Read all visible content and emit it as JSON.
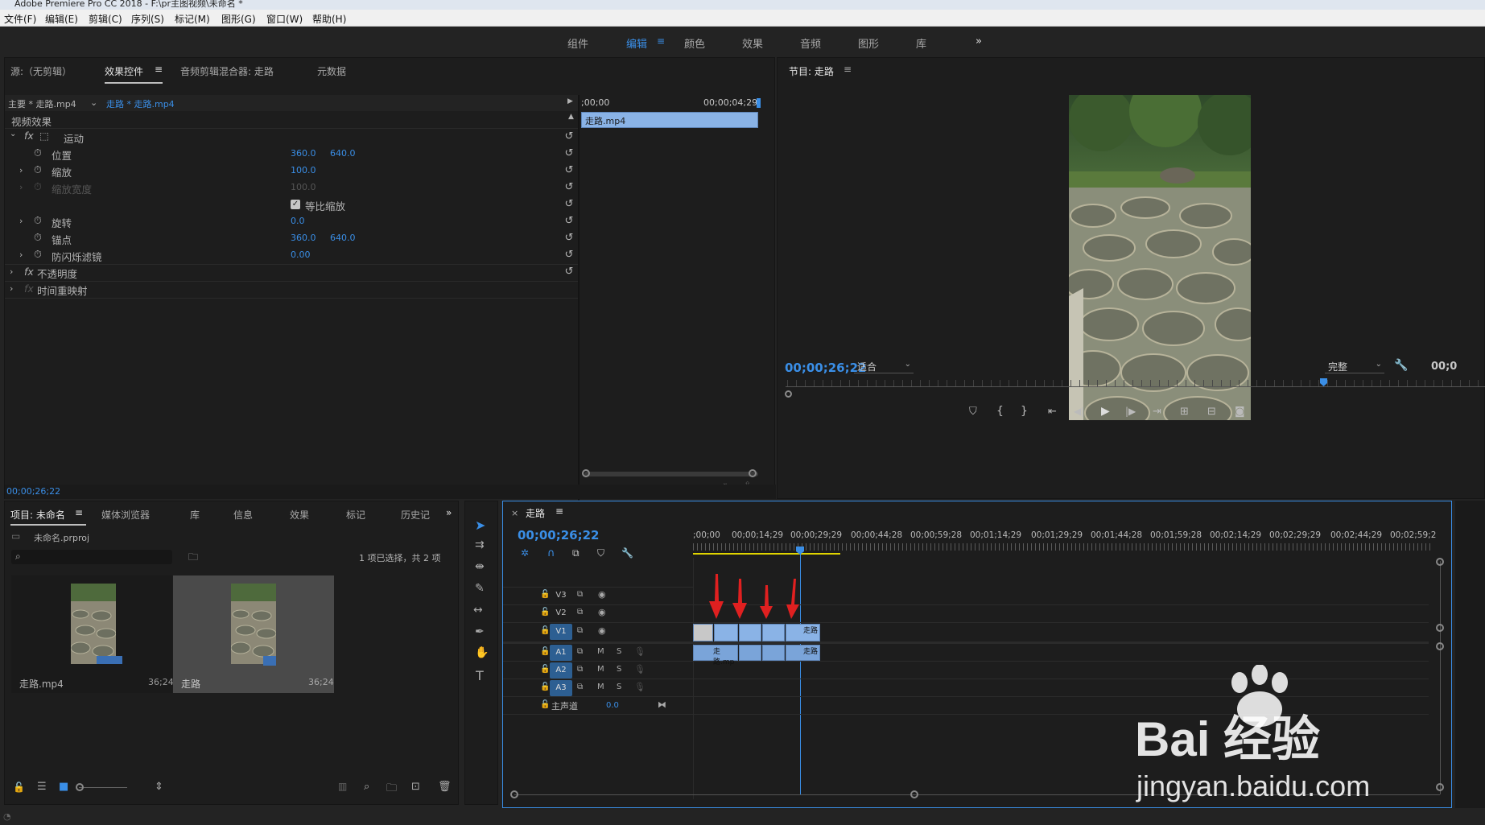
{
  "window": {
    "title": "Adobe Premiere Pro CC 2018 - F:\\pr主图视频\\未命名 *"
  },
  "menu": [
    "文件(F)",
    "编辑(E)",
    "剪辑(C)",
    "序列(S)",
    "标记(M)",
    "图形(G)",
    "窗口(W)",
    "帮助(H)"
  ],
  "workspaces": [
    "组件",
    "编辑",
    "颜色",
    "效果",
    "音频",
    "图形",
    "库"
  ],
  "effect_panel": {
    "tabs": [
      "源:（无剪辑）",
      "效果控件",
      "音频剪辑混合器: 走路",
      "元数据"
    ],
    "master_clip": "主要 * 走路.mp4",
    "seq_clip": "走路 * 走路.mp4",
    "ruler_start": ";00;00",
    "ruler_end": "00;00;04;29",
    "clip_name": "走路.mp4",
    "section_video": "视频效果",
    "motion": "运动",
    "props": [
      {
        "name": "位置",
        "v1": "360.0",
        "v2": "640.0"
      },
      {
        "name": "缩放",
        "v1": "100.0",
        "v2": ""
      },
      {
        "name": "缩放宽度",
        "v1": "100.0",
        "v2": ""
      },
      {
        "name": "旋转",
        "v1": "0.0",
        "v2": ""
      },
      {
        "name": "锚点",
        "v1": "360.0",
        "v2": "640.0"
      },
      {
        "name": "防闪烁滤镜",
        "v1": "0.00",
        "v2": ""
      }
    ],
    "uniform_scale": "等比缩放",
    "opacity": "不透明度",
    "time_remap": "时间重映射",
    "timecode": "00;00;26;22"
  },
  "program": {
    "title": "节目: 走路",
    "timecode": "00;00;26;22",
    "fit": "适合",
    "quality": "完整",
    "right_tc": "00;0"
  },
  "project": {
    "tabs": [
      "项目: 未命名",
      "媒体浏览器",
      "库",
      "信息",
      "效果",
      "标记",
      "历史记"
    ],
    "file": "未命名.prproj",
    "selection": "1 项已选择，共 2 项",
    "items": [
      {
        "name": "走路.mp4",
        "dur": "36;24"
      },
      {
        "name": "走路",
        "dur": "36;24"
      }
    ]
  },
  "timeline": {
    "title": "走路",
    "timecode": "00;00;26;22",
    "ruler": [
      ";00;00",
      "00;00;14;29",
      "00;00;29;29",
      "00;00;44;28",
      "00;00;59;28",
      "00;01;14;29",
      "00;01;29;29",
      "00;01;44;28",
      "00;01;59;28",
      "00;02;14;29",
      "00;02;29;29",
      "00;02;44;29",
      "00;02;59;2"
    ],
    "tracks_video": [
      "V3",
      "V2",
      "V1"
    ],
    "tracks_audio": [
      "A1",
      "A2",
      "A3"
    ],
    "master": "主声道",
    "master_val": "0.0",
    "clip_label": "走路.mp",
    "clip_label2": "走路"
  },
  "watermark": {
    "brand": "Bai 经验",
    "url": "jingyan.baidu.com"
  }
}
